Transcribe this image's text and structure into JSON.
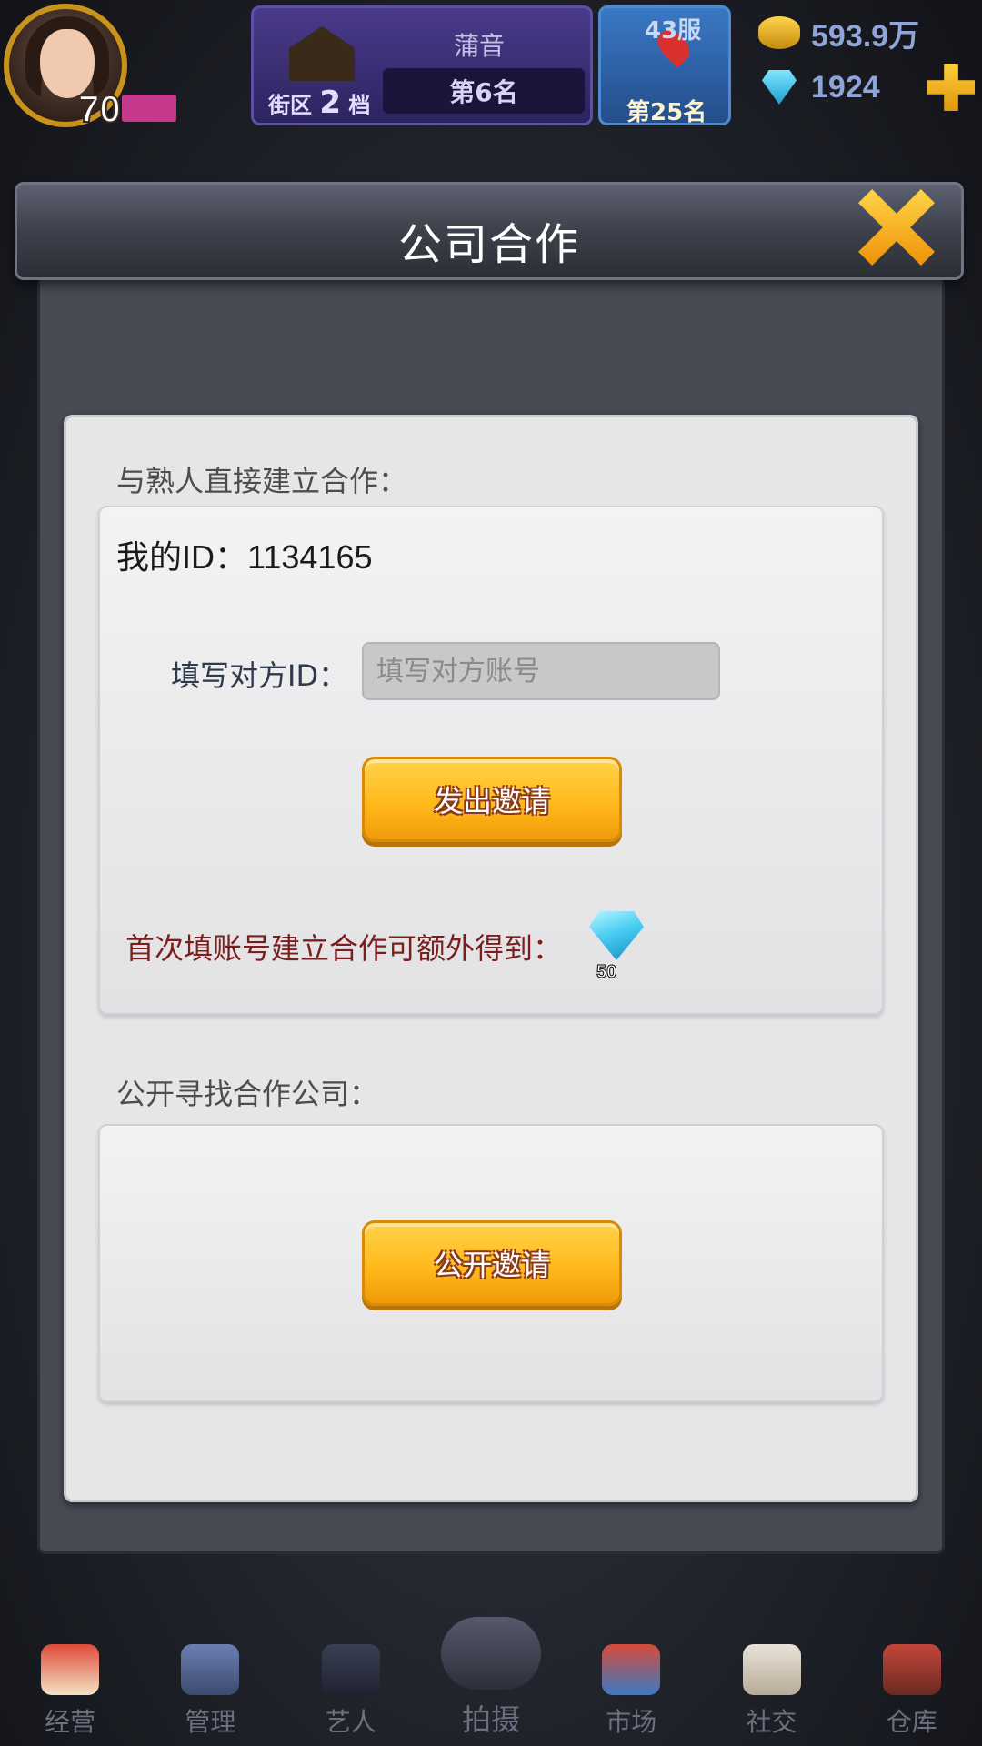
{
  "hud": {
    "level": "70",
    "district_name": "蒲音",
    "district_label_prefix": "街区",
    "district_num": "2",
    "district_label_suffix": "档",
    "district_rank": "第6名",
    "server_name": "43服",
    "server_rank": "第25名",
    "coins": "593.9万",
    "gems": "1924"
  },
  "modal": {
    "title": "公司合作",
    "direct_section_title": "与熟人直接建立合作：",
    "my_id_label": "我的ID：",
    "my_id_value": "1134165",
    "partner_label": "填写对方ID：",
    "partner_placeholder": "填写对方账号",
    "partner_value": "",
    "invite_button": "发出邀请",
    "bonus_text": "首次填账号建立合作可额外得到：",
    "bonus_gem_count": "50",
    "public_section_title": "公开寻找合作公司：",
    "public_button": "公开邀请"
  },
  "bottom_nav": {
    "items": [
      {
        "label": "经营",
        "icon": "popcorn-icon"
      },
      {
        "label": "管理",
        "icon": "management-icon"
      },
      {
        "label": "艺人",
        "icon": "artist-icon"
      },
      {
        "label": "拍摄",
        "icon": "film-camera-icon"
      },
      {
        "label": "市场",
        "icon": "market-icon"
      },
      {
        "label": "社交",
        "icon": "coffee-cup-icon"
      },
      {
        "label": "仓库",
        "icon": "warehouse-icon"
      }
    ]
  },
  "colors": {
    "gold_button": "#ffba1c",
    "bonus_text": "#7a1e1e",
    "panel_bg": "#e6e6e8",
    "header_bg": "#3e414b"
  }
}
